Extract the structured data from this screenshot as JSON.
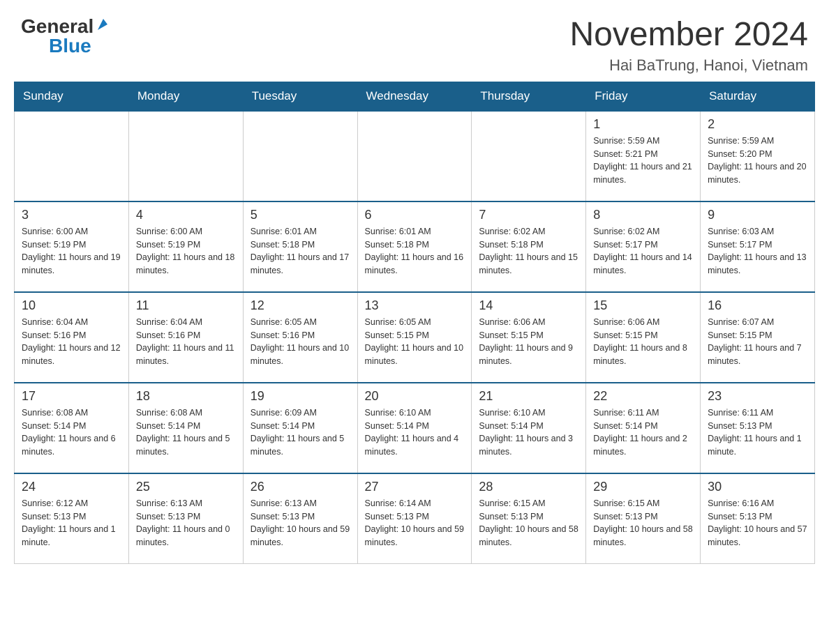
{
  "logo": {
    "general": "General",
    "blue": "Blue",
    "triangle": "▶"
  },
  "title": {
    "month_year": "November 2024",
    "location": "Hai BaTrung, Hanoi, Vietnam"
  },
  "weekdays": [
    "Sunday",
    "Monday",
    "Tuesday",
    "Wednesday",
    "Thursday",
    "Friday",
    "Saturday"
  ],
  "weeks": [
    [
      {
        "day": "",
        "sunrise": "",
        "sunset": "",
        "daylight": ""
      },
      {
        "day": "",
        "sunrise": "",
        "sunset": "",
        "daylight": ""
      },
      {
        "day": "",
        "sunrise": "",
        "sunset": "",
        "daylight": ""
      },
      {
        "day": "",
        "sunrise": "",
        "sunset": "",
        "daylight": ""
      },
      {
        "day": "",
        "sunrise": "",
        "sunset": "",
        "daylight": ""
      },
      {
        "day": "1",
        "sunrise": "Sunrise: 5:59 AM",
        "sunset": "Sunset: 5:21 PM",
        "daylight": "Daylight: 11 hours and 21 minutes."
      },
      {
        "day": "2",
        "sunrise": "Sunrise: 5:59 AM",
        "sunset": "Sunset: 5:20 PM",
        "daylight": "Daylight: 11 hours and 20 minutes."
      }
    ],
    [
      {
        "day": "3",
        "sunrise": "Sunrise: 6:00 AM",
        "sunset": "Sunset: 5:19 PM",
        "daylight": "Daylight: 11 hours and 19 minutes."
      },
      {
        "day": "4",
        "sunrise": "Sunrise: 6:00 AM",
        "sunset": "Sunset: 5:19 PM",
        "daylight": "Daylight: 11 hours and 18 minutes."
      },
      {
        "day": "5",
        "sunrise": "Sunrise: 6:01 AM",
        "sunset": "Sunset: 5:18 PM",
        "daylight": "Daylight: 11 hours and 17 minutes."
      },
      {
        "day": "6",
        "sunrise": "Sunrise: 6:01 AM",
        "sunset": "Sunset: 5:18 PM",
        "daylight": "Daylight: 11 hours and 16 minutes."
      },
      {
        "day": "7",
        "sunrise": "Sunrise: 6:02 AM",
        "sunset": "Sunset: 5:18 PM",
        "daylight": "Daylight: 11 hours and 15 minutes."
      },
      {
        "day": "8",
        "sunrise": "Sunrise: 6:02 AM",
        "sunset": "Sunset: 5:17 PM",
        "daylight": "Daylight: 11 hours and 14 minutes."
      },
      {
        "day": "9",
        "sunrise": "Sunrise: 6:03 AM",
        "sunset": "Sunset: 5:17 PM",
        "daylight": "Daylight: 11 hours and 13 minutes."
      }
    ],
    [
      {
        "day": "10",
        "sunrise": "Sunrise: 6:04 AM",
        "sunset": "Sunset: 5:16 PM",
        "daylight": "Daylight: 11 hours and 12 minutes."
      },
      {
        "day": "11",
        "sunrise": "Sunrise: 6:04 AM",
        "sunset": "Sunset: 5:16 PM",
        "daylight": "Daylight: 11 hours and 11 minutes."
      },
      {
        "day": "12",
        "sunrise": "Sunrise: 6:05 AM",
        "sunset": "Sunset: 5:16 PM",
        "daylight": "Daylight: 11 hours and 10 minutes."
      },
      {
        "day": "13",
        "sunrise": "Sunrise: 6:05 AM",
        "sunset": "Sunset: 5:15 PM",
        "daylight": "Daylight: 11 hours and 10 minutes."
      },
      {
        "day": "14",
        "sunrise": "Sunrise: 6:06 AM",
        "sunset": "Sunset: 5:15 PM",
        "daylight": "Daylight: 11 hours and 9 minutes."
      },
      {
        "day": "15",
        "sunrise": "Sunrise: 6:06 AM",
        "sunset": "Sunset: 5:15 PM",
        "daylight": "Daylight: 11 hours and 8 minutes."
      },
      {
        "day": "16",
        "sunrise": "Sunrise: 6:07 AM",
        "sunset": "Sunset: 5:15 PM",
        "daylight": "Daylight: 11 hours and 7 minutes."
      }
    ],
    [
      {
        "day": "17",
        "sunrise": "Sunrise: 6:08 AM",
        "sunset": "Sunset: 5:14 PM",
        "daylight": "Daylight: 11 hours and 6 minutes."
      },
      {
        "day": "18",
        "sunrise": "Sunrise: 6:08 AM",
        "sunset": "Sunset: 5:14 PM",
        "daylight": "Daylight: 11 hours and 5 minutes."
      },
      {
        "day": "19",
        "sunrise": "Sunrise: 6:09 AM",
        "sunset": "Sunset: 5:14 PM",
        "daylight": "Daylight: 11 hours and 5 minutes."
      },
      {
        "day": "20",
        "sunrise": "Sunrise: 6:10 AM",
        "sunset": "Sunset: 5:14 PM",
        "daylight": "Daylight: 11 hours and 4 minutes."
      },
      {
        "day": "21",
        "sunrise": "Sunrise: 6:10 AM",
        "sunset": "Sunset: 5:14 PM",
        "daylight": "Daylight: 11 hours and 3 minutes."
      },
      {
        "day": "22",
        "sunrise": "Sunrise: 6:11 AM",
        "sunset": "Sunset: 5:14 PM",
        "daylight": "Daylight: 11 hours and 2 minutes."
      },
      {
        "day": "23",
        "sunrise": "Sunrise: 6:11 AM",
        "sunset": "Sunset: 5:13 PM",
        "daylight": "Daylight: 11 hours and 1 minute."
      }
    ],
    [
      {
        "day": "24",
        "sunrise": "Sunrise: 6:12 AM",
        "sunset": "Sunset: 5:13 PM",
        "daylight": "Daylight: 11 hours and 1 minute."
      },
      {
        "day": "25",
        "sunrise": "Sunrise: 6:13 AM",
        "sunset": "Sunset: 5:13 PM",
        "daylight": "Daylight: 11 hours and 0 minutes."
      },
      {
        "day": "26",
        "sunrise": "Sunrise: 6:13 AM",
        "sunset": "Sunset: 5:13 PM",
        "daylight": "Daylight: 10 hours and 59 minutes."
      },
      {
        "day": "27",
        "sunrise": "Sunrise: 6:14 AM",
        "sunset": "Sunset: 5:13 PM",
        "daylight": "Daylight: 10 hours and 59 minutes."
      },
      {
        "day": "28",
        "sunrise": "Sunrise: 6:15 AM",
        "sunset": "Sunset: 5:13 PM",
        "daylight": "Daylight: 10 hours and 58 minutes."
      },
      {
        "day": "29",
        "sunrise": "Sunrise: 6:15 AM",
        "sunset": "Sunset: 5:13 PM",
        "daylight": "Daylight: 10 hours and 58 minutes."
      },
      {
        "day": "30",
        "sunrise": "Sunrise: 6:16 AM",
        "sunset": "Sunset: 5:13 PM",
        "daylight": "Daylight: 10 hours and 57 minutes."
      }
    ]
  ]
}
